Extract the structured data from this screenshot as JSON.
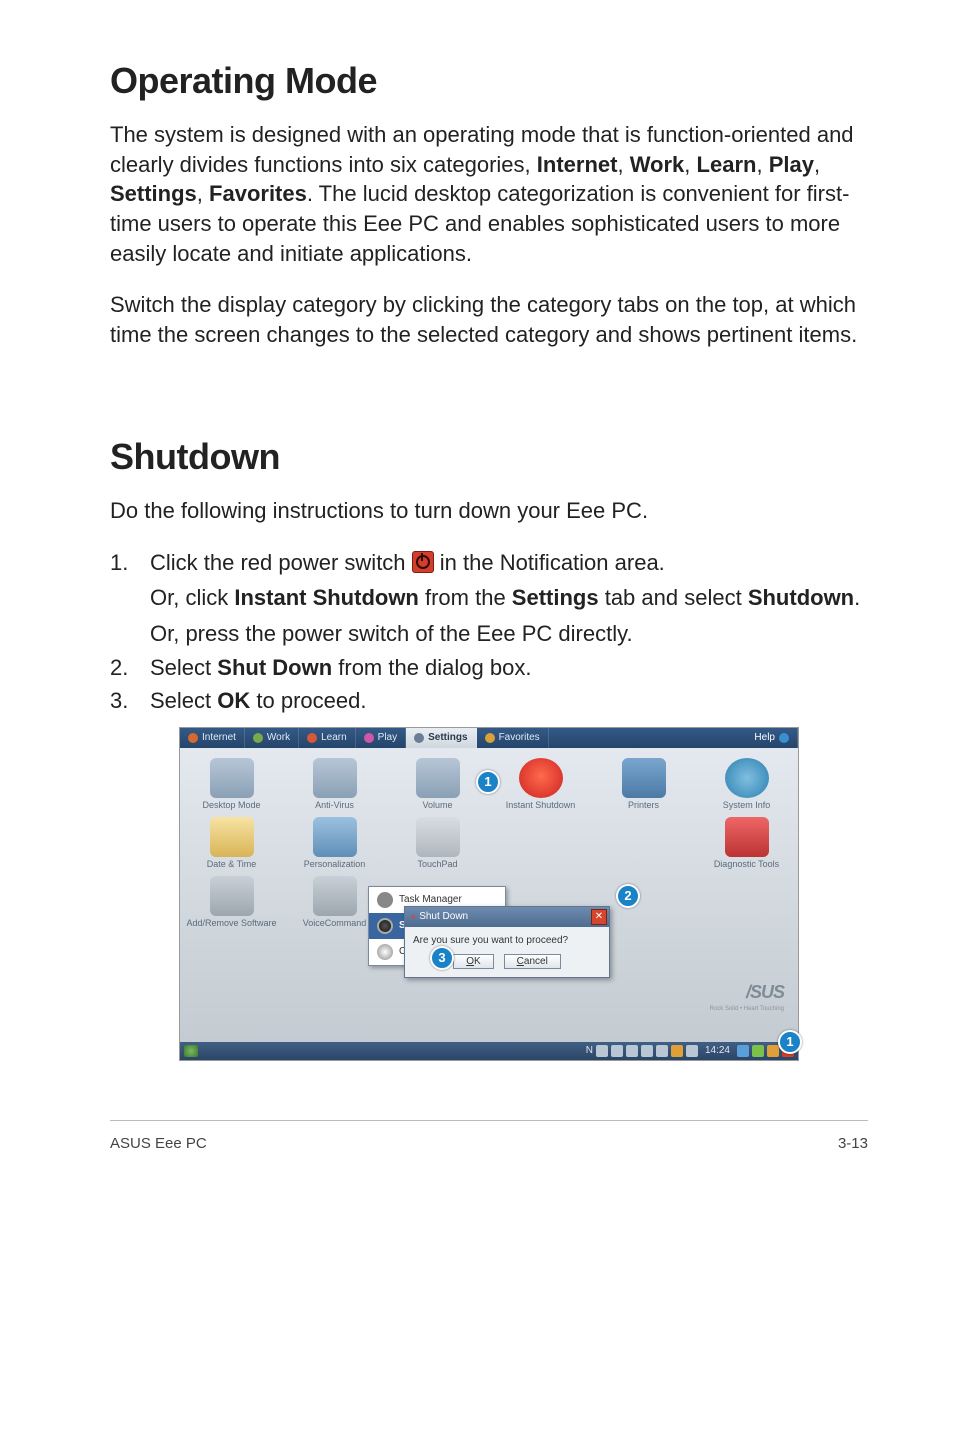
{
  "heading1": "Operating Mode",
  "para1_pre": "The system is designed with an operating mode that is function-oriented and clearly divides functions into six categories, ",
  "cats": {
    "c1": "Internet",
    "c2": "Work",
    "c3": "Learn",
    "c4": "Play",
    "c5": "Settings",
    "c6": "Favorites"
  },
  "para1_post": ". The lucid desktop categorization is convenient for first-time users to operate this Eee PC and enables sophisticated users to more easily locate and initiate applications.",
  "para2": "Switch the display category by clicking the category tabs on the top, at which time the screen changes to the selected category and shows pertinent items.",
  "heading2": "Shutdown",
  "para3": "Do the following instructions to turn down your Eee PC.",
  "steps": {
    "s1": {
      "num": "1.",
      "a_pre": "Click the red power switch ",
      "a_post": " in the Notification area.",
      "b_pre": "Or, click ",
      "b_b1": "Instant Shutdown",
      "b_mid": " from the ",
      "b_b2": "Settings",
      "b_post": " tab and select ",
      "b_b3": "Shutdown",
      "b_end": ".",
      "c": "Or, press the power switch of the Eee PC directly."
    },
    "s2": {
      "num": "2.",
      "pre": "Select ",
      "b": "Shut Down",
      "post": " from the dialog box."
    },
    "s3": {
      "num": "3.",
      "pre": "Select ",
      "b": "OK",
      "post": " to proceed."
    }
  },
  "shot": {
    "tabs": {
      "internet": "Internet",
      "work": "Work",
      "learn": "Learn",
      "play": "Play",
      "settings": "Settings",
      "favorites": "Favorites",
      "help": "Help"
    },
    "icons": {
      "desktop": "Desktop Mode",
      "antivirus": "Anti-Virus",
      "volume": "Volume",
      "instant": "Instant Shutdown",
      "printers": "Printers",
      "sysinfo": "System Info",
      "datetime": "Date & Time",
      "personal": "Personalization",
      "touchpad": "TouchPad",
      "diag": "Diagnostic Tools",
      "addremove": "Add/Remove Software",
      "voice": "VoiceCommand"
    },
    "ctx": {
      "task": "Task Manager",
      "shutdown": "Shut Down",
      "cancel": "Cancel"
    },
    "dlg": {
      "title": "Shut Down",
      "msg": "Are you sure you want to proceed?",
      "ok": "OK",
      "cancel": "Cancel"
    },
    "asus": "/SUS",
    "asus_sub": "Rock Solid • Heart Touching",
    "tray": {
      "net": "N",
      "clock": "14:24"
    },
    "markers": {
      "m1": "1",
      "m2": "2",
      "m3": "3"
    }
  },
  "footer": {
    "left": "ASUS Eee PC",
    "right": "3-13"
  }
}
